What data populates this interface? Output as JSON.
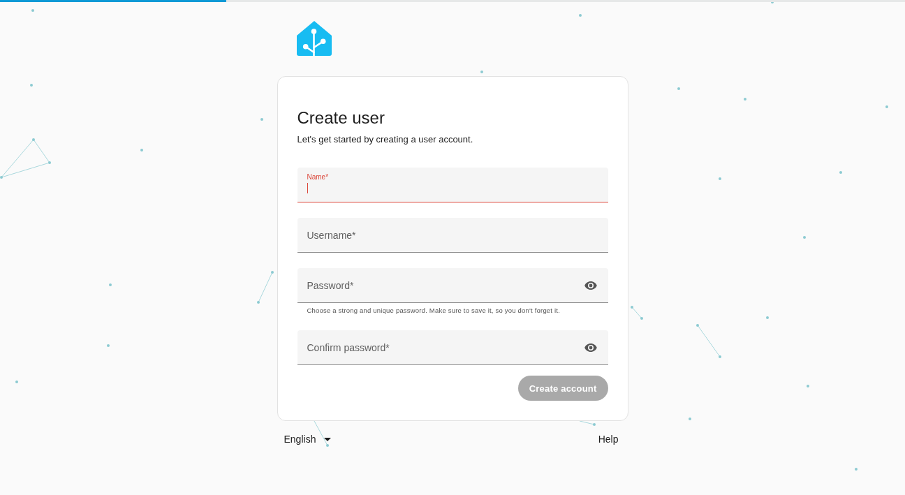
{
  "progress": {
    "level": 0.25
  },
  "card": {
    "title": "Create user",
    "subtitle": "Let's get started by creating a user account.",
    "fields": [
      {
        "label": "Name*",
        "kind": "text",
        "focused": true,
        "invalid": true
      },
      {
        "label": "Username*",
        "kind": "text",
        "focused": false,
        "invalid": false
      },
      {
        "label": "Password*",
        "kind": "password",
        "focused": false,
        "invalid": false,
        "helper": "Choose a strong and unique password. Make sure to save it, so you don't forget it."
      },
      {
        "label": "Confirm password*",
        "kind": "password",
        "focused": false,
        "invalid": false
      }
    ],
    "submit_button": {
      "label": "Create account",
      "disabled": true
    }
  },
  "footer": {
    "language": "English",
    "help_link": "Help"
  }
}
